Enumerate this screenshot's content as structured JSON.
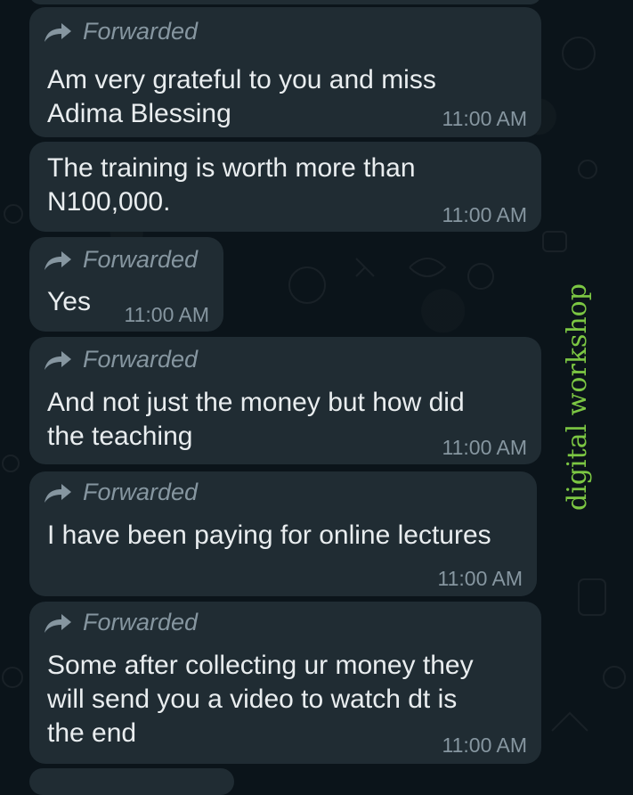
{
  "chat": {
    "messages": [
      {
        "forwarded_label": "Forwarded",
        "text": "Am very grateful to you and miss\nAdima Blessing",
        "time": "11:00 AM"
      },
      {
        "text": "The training is worth more than\nN100,000.",
        "time": "11:00 AM"
      },
      {
        "forwarded_label": "Forwarded",
        "text": "Yes",
        "time": "11:00 AM"
      },
      {
        "forwarded_label": "Forwarded",
        "text": "And not just the money but how did\nthe teaching",
        "time": "11:00 AM"
      },
      {
        "forwarded_label": "Forwarded",
        "text": "I have been paying for online lectures",
        "time": "11:00 AM"
      },
      {
        "forwarded_label": "Forwarded",
        "text": "Some after collecting ur money they\nwill send you a video to watch dt is\nthe end",
        "time": "11:00 AM"
      }
    ]
  },
  "watermark": {
    "text": "digital workshop"
  },
  "colors": {
    "background": "#0b141a",
    "bubble": "#202c33",
    "text": "#e9edef",
    "meta": "#8696a0",
    "watermark": "#7cc743"
  },
  "icons": {
    "forward": "forward-arrow-icon"
  }
}
